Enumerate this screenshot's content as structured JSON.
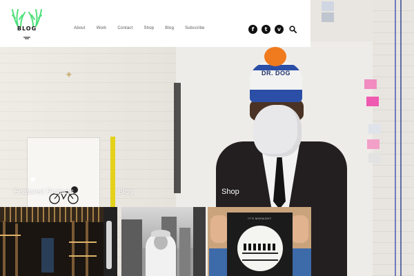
{
  "site": {
    "logo_text": "BLOG"
  },
  "nav": {
    "items": [
      {
        "label": "About"
      },
      {
        "label": "Work"
      },
      {
        "label": "Contact"
      },
      {
        "label": "Shop"
      },
      {
        "label": "Blog"
      },
      {
        "label": "Subscribe"
      }
    ]
  },
  "social": {
    "facebook": "f",
    "twitter": "t",
    "vimeo": "v",
    "search_icon": "search-icon"
  },
  "hero": {
    "beanie_text": "DR. DOG"
  },
  "sections": {
    "featured": "Featured Projects",
    "blog": "Blog",
    "shop": "Shop"
  },
  "shop_tile": {
    "poster_title": "IT'S MIDNIGHT"
  },
  "colors": {
    "logo_green": "#4ee07a",
    "header_bg": "#ffffff",
    "beanie_blue": "#2b4ea6",
    "pompom_orange": "#f07a1e"
  }
}
